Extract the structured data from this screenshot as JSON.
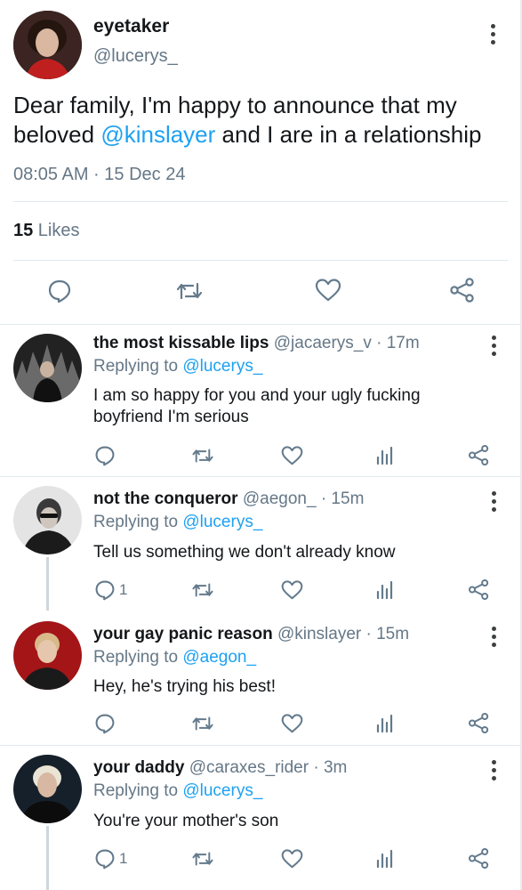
{
  "main_tweet": {
    "display_name": "eyetaker",
    "handle": "@lucerys_",
    "text_before": "Dear family, I'm happy to announce that my beloved ",
    "mention": "@kinslayer",
    "text_after": " and I are in a relationship",
    "timestamp": "08:05 AM · 15 Dec 24",
    "like_count": "15",
    "likes_label": " Likes",
    "actions": [
      "reply-icon",
      "retweet-icon",
      "like-icon",
      "share-icon"
    ]
  },
  "replies": [
    {
      "display_name": "the most kissable lips",
      "handle": "@jacaerys_v",
      "time": " · 17m",
      "replying_label": "Replying to ",
      "replying_to": "@lucerys_",
      "text": "I am so happy for you and your ugly fucking boyfriend I'm serious",
      "reply_count": ""
    },
    {
      "display_name": "not the conqueror",
      "handle": "@aegon_",
      "time": " · 15m",
      "replying_label": "Replying to ",
      "replying_to": "@lucerys_",
      "text": "Tell us something we don't already know",
      "reply_count": "1"
    },
    {
      "display_name": "your gay panic reason",
      "handle": "@kinslayer",
      "time": " · 15m",
      "replying_label": "Replying to ",
      "replying_to": "@aegon_",
      "text": "Hey, he's trying his best!",
      "reply_count": ""
    },
    {
      "display_name": "your daddy",
      "handle": "@caraxes_rider",
      "time": " · 3m",
      "replying_label": "Replying to ",
      "replying_to": "@lucerys_",
      "text": "You're your mother's son",
      "reply_count": "1"
    }
  ],
  "colors": {
    "accent": "#1da1f2",
    "secondary_text": "#657786",
    "icon": "#637a8c",
    "divider": "#e1e8ed"
  }
}
